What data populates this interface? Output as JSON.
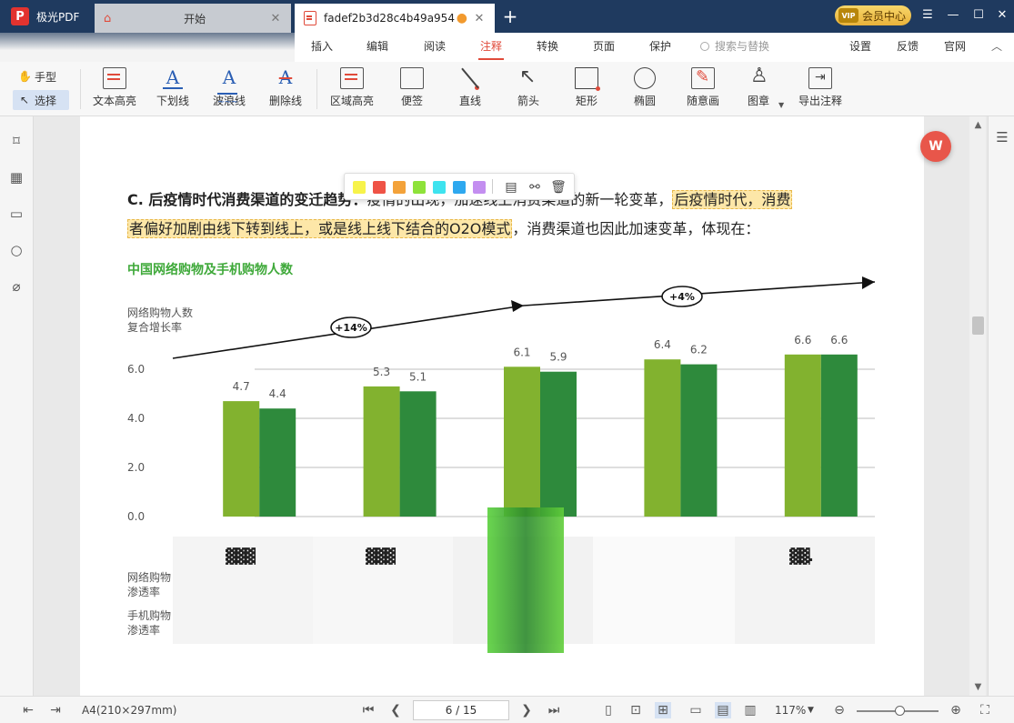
{
  "app": {
    "name": "极光PDF",
    "logo": "P"
  },
  "tabs": [
    {
      "label": "开始"
    },
    {
      "label": "fadef2b3d28c4b49a9548..."
    }
  ],
  "window": {
    "vip_label": "会员中心",
    "vip_badge": "VIP"
  },
  "menu": {
    "items": [
      "插入",
      "编辑",
      "阅读",
      "注释",
      "转换",
      "页面",
      "保护"
    ],
    "active": "注释",
    "search_placeholder": "搜索与替换",
    "right_items": [
      "设置",
      "反馈",
      "官网"
    ]
  },
  "toolbar": {
    "hand": "手型",
    "select": "选择",
    "tools": [
      "文本高亮",
      "下划线",
      "波浪线",
      "删除线",
      "区域高亮",
      "便签",
      "直线",
      "箭头",
      "矩形",
      "椭圆",
      "随意画",
      "图章",
      "导出注释"
    ]
  },
  "document": {
    "line1_bold": "C. 后疫情时代消费渠道的变迁趋势：",
    "line1_rest": "疫情的出现，加速线上消费渠道的新一轮变革，",
    "line1_hl": "后疫情时代，消费",
    "line2_hl": "者偏好加剧由线下转到线上，或是线上线下结合的O2O模式",
    "line2_rest": "，消费渠道也因此加速变革，体现在："
  },
  "popup_colors": [
    "#f7f34a",
    "#ef5346",
    "#f3a23a",
    "#8ee23a",
    "#3ee3ef",
    "#2ea8ef",
    "#c38ef0"
  ],
  "chart_data": {
    "type": "bar",
    "title": "中国网络购物及手机购物人数",
    "ylabel": "网络购物人数复合增长率",
    "ylabel_lines": [
      "网络购物人数",
      "复合增长率"
    ],
    "ylim": [
      0,
      6.0
    ],
    "yticks": [
      "0.0",
      "2.0",
      "4.0",
      "6.0"
    ],
    "categories": [
      "",
      "",
      "",
      "",
      ""
    ],
    "series": [
      {
        "color": "#82b22f",
        "values": [
          4.7,
          5.3,
          6.1,
          6.4,
          6.6
        ]
      },
      {
        "color": "#2e8a3c",
        "values": [
          4.4,
          5.1,
          5.9,
          6.2,
          6.6
        ]
      }
    ],
    "growth_labels": [
      "+14%",
      "+4%"
    ],
    "row_labels": [
      [
        "网络购物",
        "渗透率"
      ],
      [
        "手机购物",
        "渗透率"
      ]
    ]
  },
  "status": {
    "page_size": "A4(210×297mm)",
    "page_indicator": "6 / 15",
    "zoom": "117%",
    "zoom_level": 0.52
  }
}
